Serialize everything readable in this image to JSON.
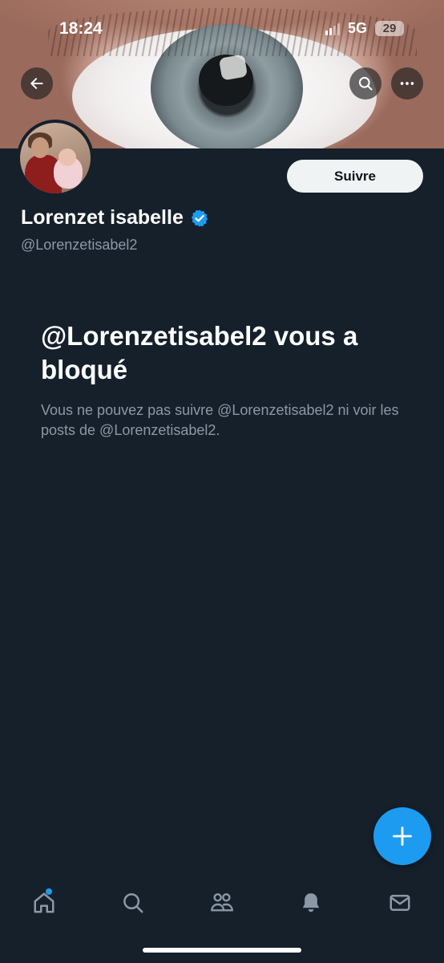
{
  "status_bar": {
    "time": "18:24",
    "network": "5G",
    "battery": "29"
  },
  "header": {
    "back_icon": "arrow-left-icon",
    "search_icon": "search-icon",
    "more_icon": "more-horizontal-icon"
  },
  "profile": {
    "display_name": "Lorenzet isabelle",
    "verified": true,
    "verified_color": "#1d9bf0",
    "handle": "@Lorenzetisabel2",
    "follow_label": "Suivre"
  },
  "blocked": {
    "title": "@Lorenzetisabel2 vous a bloqué",
    "description": "Vous ne pouvez pas suivre @Lorenzetisabel2 ni voir les posts de @Lorenzetisabel2."
  },
  "fab": {
    "icon": "plus-icon",
    "color": "#1d9bf0"
  },
  "bottom_nav": [
    {
      "name": "home",
      "icon": "home-icon",
      "has_notification_dot": true
    },
    {
      "name": "search",
      "icon": "search-icon"
    },
    {
      "name": "communities",
      "icon": "people-icon"
    },
    {
      "name": "notifications",
      "icon": "bell-icon"
    },
    {
      "name": "messages",
      "icon": "mail-icon"
    }
  ],
  "colors": {
    "background": "#15202b",
    "secondary_text": "#8b98a5",
    "accent": "#1d9bf0"
  }
}
